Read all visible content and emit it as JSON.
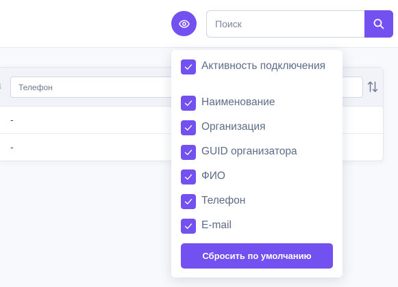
{
  "header": {
    "visibility_toggle_icon": "eye-icon",
    "search": {
      "placeholder": "Поиск",
      "value": "",
      "button_icon": "search-icon"
    }
  },
  "table": {
    "filter": {
      "placeholder": "Телефон",
      "value": ""
    },
    "sort_icon": "sort-arrows-icon",
    "rows": [
      {
        "value": "-"
      },
      {
        "value": "-"
      }
    ]
  },
  "column_menu": {
    "options": [
      {
        "label": "Активность подключения",
        "checked": true
      },
      {
        "label": "Наименование",
        "checked": true
      },
      {
        "label": "Организация",
        "checked": true
      },
      {
        "label": "GUID организатора",
        "checked": true
      },
      {
        "label": "ФИО",
        "checked": true
      },
      {
        "label": "Телефон",
        "checked": true
      },
      {
        "label": "E-mail",
        "checked": true
      }
    ],
    "reset_label": "Сбросить по умолчанию"
  },
  "colors": {
    "accent": "#7350f0",
    "background": "#f8f9fc"
  }
}
